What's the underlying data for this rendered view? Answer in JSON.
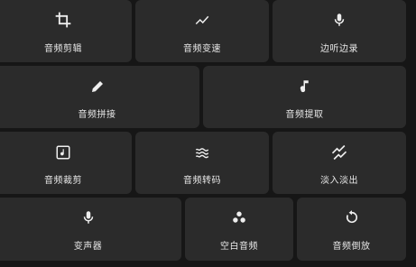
{
  "tools": {
    "crop": {
      "label": "音频剪辑",
      "icon": "crop-icon"
    },
    "speed": {
      "label": "音频变速",
      "icon": "trending-up-icon"
    },
    "record": {
      "label": "边听边录",
      "icon": "mic-icon"
    },
    "join": {
      "label": "音频拼接",
      "icon": "pencil-icon"
    },
    "extract": {
      "label": "音频提取",
      "icon": "music-note-icon"
    },
    "cut": {
      "label": "音频裁剪",
      "icon": "music-box-icon"
    },
    "convert": {
      "label": "音频转码",
      "icon": "waves-icon"
    },
    "fade": {
      "label": "淡入淡出",
      "icon": "double-trend-icon"
    },
    "voice": {
      "label": "变声器",
      "icon": "mic-icon"
    },
    "silence": {
      "label": "空白音频",
      "icon": "three-dots-icon"
    },
    "reverse": {
      "label": "音频倒放",
      "icon": "rotate-icon"
    }
  }
}
